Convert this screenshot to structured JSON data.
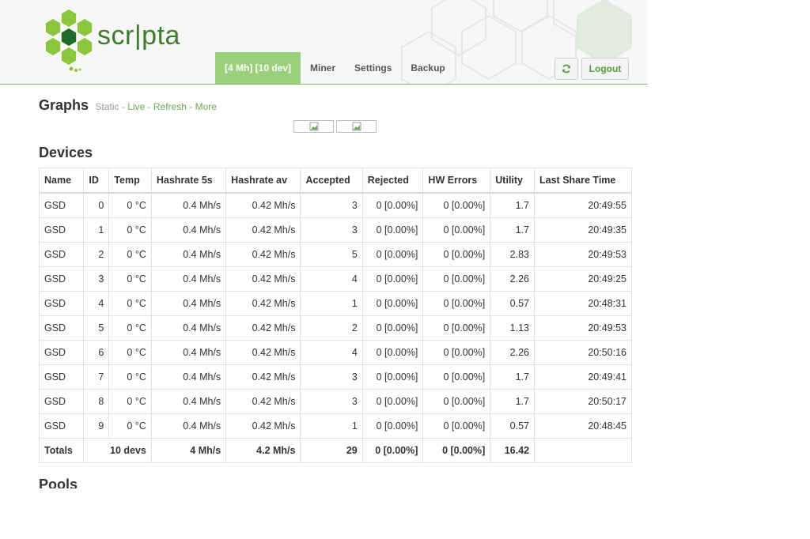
{
  "app": {
    "logo_text": "scr|pta"
  },
  "nav": {
    "items": [
      "[4 Mh] [10 dev]",
      "Miner",
      "Settings",
      "Backup"
    ],
    "active": 0,
    "logout_label": "Logout"
  },
  "graphs": {
    "title": "Graphs",
    "static_label": "Static",
    "sep": "-",
    "links": [
      "Live",
      "Refresh",
      "More"
    ]
  },
  "devices": {
    "title": "Devices",
    "columns": [
      "Name",
      "ID",
      "Temp",
      "Hashrate 5s",
      "Hashrate av",
      "Accepted",
      "Rejected",
      "HW Errors",
      "Utility",
      "Last Share Time"
    ],
    "rows": [
      [
        "GSD",
        "0",
        "0 °C",
        "0.4 Mh/s",
        "0.42 Mh/s",
        "3",
        "0 [0.00%]",
        "0 [0.00%]",
        "1.7",
        "20:49:55"
      ],
      [
        "GSD",
        "1",
        "0 °C",
        "0.4 Mh/s",
        "0.42 Mh/s",
        "3",
        "0 [0.00%]",
        "0 [0.00%]",
        "1.7",
        "20:49:35"
      ],
      [
        "GSD",
        "2",
        "0 °C",
        "0.4 Mh/s",
        "0.42 Mh/s",
        "5",
        "0 [0.00%]",
        "0 [0.00%]",
        "2.83",
        "20:49:53"
      ],
      [
        "GSD",
        "3",
        "0 °C",
        "0.4 Mh/s",
        "0.42 Mh/s",
        "4",
        "0 [0.00%]",
        "0 [0.00%]",
        "2.26",
        "20:49:25"
      ],
      [
        "GSD",
        "4",
        "0 °C",
        "0.4 Mh/s",
        "0.42 Mh/s",
        "1",
        "0 [0.00%]",
        "0 [0.00%]",
        "0.57",
        "20:48:31"
      ],
      [
        "GSD",
        "5",
        "0 °C",
        "0.4 Mh/s",
        "0.42 Mh/s",
        "2",
        "0 [0.00%]",
        "0 [0.00%]",
        "1.13",
        "20:49:53"
      ],
      [
        "GSD",
        "6",
        "0 °C",
        "0.4 Mh/s",
        "0.42 Mh/s",
        "4",
        "0 [0.00%]",
        "0 [0.00%]",
        "2.26",
        "20:50:16"
      ],
      [
        "GSD",
        "7",
        "0 °C",
        "0.4 Mh/s",
        "0.42 Mh/s",
        "3",
        "0 [0.00%]",
        "0 [0.00%]",
        "1.7",
        "20:49:41"
      ],
      [
        "GSD",
        "8",
        "0 °C",
        "0.4 Mh/s",
        "0.42 Mh/s",
        "3",
        "0 [0.00%]",
        "0 [0.00%]",
        "1.7",
        "20:50:17"
      ],
      [
        "GSD",
        "9",
        "0 °C",
        "0.4 Mh/s",
        "0.42 Mh/s",
        "1",
        "0 [0.00%]",
        "0 [0.00%]",
        "0.57",
        "20:48:45"
      ]
    ],
    "totals": {
      "label": "Totals",
      "devs": "10 devs",
      "hashrate_5s": "4 Mh/s",
      "hashrate_av": "4.2 Mh/s",
      "accepted": "29",
      "rejected": "0 [0.00%]",
      "hw_errors": "0 [0.00%]",
      "utility": "16.42",
      "last_share": ""
    }
  },
  "pools": {
    "title": "Pools"
  },
  "colors": {
    "accent": "#9bd07a",
    "link": "#6aa84f",
    "logo_green": "#5aa02c"
  },
  "icons": {
    "refresh": "refresh-icon",
    "broken_image": "broken-image-icon"
  }
}
